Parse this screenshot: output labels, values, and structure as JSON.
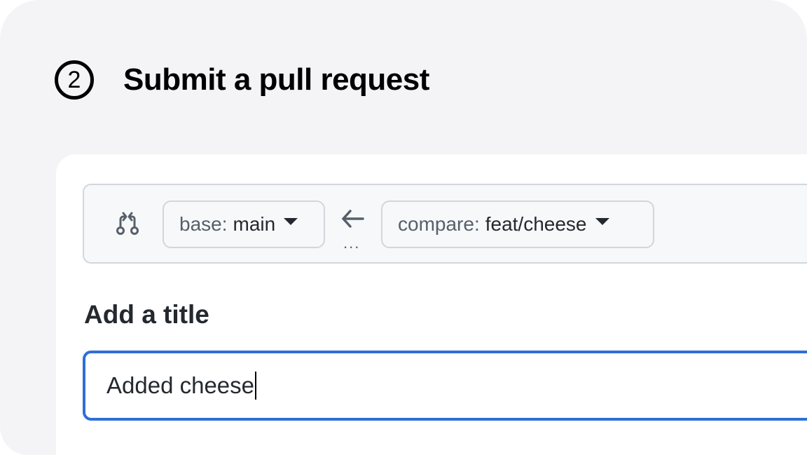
{
  "step": {
    "number": "2",
    "title": "Submit a pull request"
  },
  "branches": {
    "compare_icon": "git-compare-icon",
    "base_prefix": "base:",
    "base_value": "main",
    "arrow_icon": "arrow-left-icon",
    "dots": "...",
    "compare_prefix": "compare:",
    "compare_value": "feat/cheese"
  },
  "title_field": {
    "label": "Add a title",
    "value": "Added cheese"
  },
  "colors": {
    "background": "#f4f4f6",
    "panel": "#ffffff",
    "input_focus_border": "#2f6fd6",
    "text": "#24292f",
    "muted_text": "#57606a",
    "border": "#d0d7de"
  }
}
